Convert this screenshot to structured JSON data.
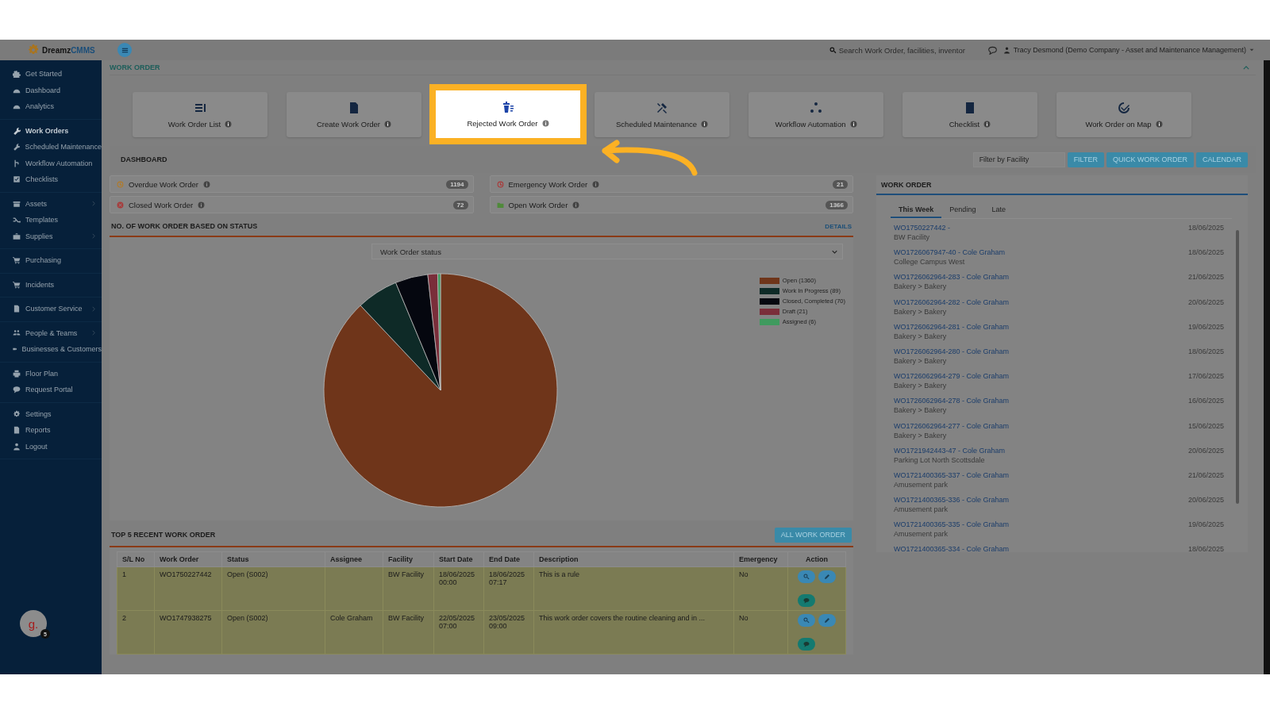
{
  "logo": {
    "name": "Dreamz",
    "accent": "CMMS"
  },
  "header": {
    "search": {
      "placeholder": "Search Work Order, facilities, inventor"
    },
    "user": "Tracy Desmond (Demo Company - Asset and Maintenance Management)"
  },
  "sidebar": {
    "groups": [
      [
        {
          "label": "Get Started",
          "selected": false,
          "expandable": false
        },
        {
          "label": "Dashboard",
          "selected": false,
          "expandable": false
        },
        {
          "label": "Analytics",
          "selected": false,
          "expandable": false
        }
      ],
      [
        {
          "label": "Work Orders",
          "selected": true,
          "expandable": false
        },
        {
          "label": "Scheduled Maintenance",
          "selected": false,
          "expandable": false
        },
        {
          "label": "Workflow Automation",
          "selected": false,
          "expandable": false
        },
        {
          "label": "Checklists",
          "selected": false,
          "expandable": false
        }
      ],
      [
        {
          "label": "Assets",
          "selected": false,
          "expandable": true
        },
        {
          "label": "Templates",
          "selected": false,
          "expandable": false
        },
        {
          "label": "Supplies",
          "selected": false,
          "expandable": true
        }
      ],
      [
        {
          "label": "Purchasing",
          "selected": false,
          "expandable": false
        }
      ],
      [
        {
          "label": "Incidents",
          "selected": false,
          "expandable": false
        }
      ],
      [
        {
          "label": "Customer Service",
          "selected": false,
          "expandable": true
        }
      ],
      [
        {
          "label": "People & Teams",
          "selected": false,
          "expandable": true
        },
        {
          "label": "Businesses & Customers",
          "selected": false,
          "expandable": false
        }
      ],
      [
        {
          "label": "Floor Plan",
          "selected": false,
          "expandable": false
        },
        {
          "label": "Request Portal",
          "selected": false,
          "expandable": false
        }
      ],
      [
        {
          "label": "Settings",
          "selected": false,
          "expandable": false
        },
        {
          "label": "Reports",
          "selected": false,
          "expandable": false
        },
        {
          "label": "Logout",
          "selected": false,
          "expandable": false
        }
      ]
    ]
  },
  "avatar": {
    "letter": "g.",
    "badge": "5"
  },
  "section_title": "WORK ORDER",
  "cards": [
    {
      "label": "Work Order List",
      "highlighted": false
    },
    {
      "label": "Create Work Order",
      "highlighted": false
    },
    {
      "label": "Rejected Work Order",
      "highlighted": true
    },
    {
      "label": "Scheduled Maintenance",
      "highlighted": false
    },
    {
      "label": "Workflow Automation",
      "highlighted": false
    },
    {
      "label": "Checklist",
      "highlighted": false
    },
    {
      "label": "Work Order on Map",
      "highlighted": false
    }
  ],
  "dashboard": {
    "title": "DASHBOARD",
    "filter": {
      "placeholder": "Filter by Facility"
    },
    "buttons": [
      "FILTER",
      "QUICK WORK ORDER",
      "CALENDAR"
    ]
  },
  "stats": [
    {
      "kind": "clock",
      "label": "Overdue Work Order",
      "count": "1194",
      "color": "#b07a2a"
    },
    {
      "kind": "clock",
      "label": "Emergency Work Order",
      "count": "21",
      "color": "#a83a3a"
    },
    {
      "kind": "cancel",
      "label": "Closed Work Order",
      "count": "72",
      "color": "#a83a3a"
    },
    {
      "kind": "folder",
      "label": "Open Work Order",
      "count": "1366",
      "color": "#4f8a3a"
    }
  ],
  "status_chart": {
    "title": "NO. OF WORK ORDER BASED ON STATUS",
    "details": "DETAILS",
    "select": "Work Order status",
    "legend": [
      {
        "color": "#6f351a"
      },
      {
        "color": "#0e2a27"
      },
      {
        "color": "#05070f"
      },
      {
        "color": "#7a2e3a"
      },
      {
        "color": "#3f9a5e"
      }
    ],
    "chart_data": {
      "type": "pie",
      "categories": [
        "Open (1360)",
        "Work In Progress (89)",
        "Closed, Completed (70)",
        "Draft (21)",
        "Assigned (6)"
      ],
      "values": [
        1360,
        89,
        70,
        21,
        6
      ],
      "legend": "right"
    }
  },
  "recent": {
    "title": "TOP 5 RECENT WORK ORDER",
    "button": "ALL WORK ORDER",
    "columns": [
      "S/L No",
      "Work Order",
      "Status",
      "Assignee",
      "Facility",
      "Start Date",
      "End Date",
      "Description",
      "Emergency",
      "Action"
    ],
    "rows": [
      {
        "cells": [
          "1",
          "WO1750227442",
          "Open (S002)",
          "",
          "BW Facility",
          "18/06/2025 00:00",
          "18/06/2025 07:17",
          "This is a rule",
          "No"
        ]
      },
      {
        "cells": [
          "2",
          "WO1747938275",
          "Open (S002)",
          "Cole Graham",
          "BW Facility",
          "22/05/2025 07:00",
          "23/05/2025 09:00",
          "This work order covers the routine cleaning and in ...",
          "No"
        ]
      }
    ]
  },
  "work_order_panel": {
    "title": "WORK ORDER",
    "tabs": [
      {
        "label": "This Week",
        "selected": true
      },
      {
        "label": "Pending",
        "selected": false
      },
      {
        "label": "Late",
        "selected": false
      }
    ],
    "items": [
      {
        "title": "WO1750227442 -",
        "place": "BW Facility",
        "date": "18/06/2025"
      },
      {
        "title": "WO1726067947-40 - Cole Graham",
        "place": "College Campus West",
        "date": "18/06/2025"
      },
      {
        "title": "WO1726062964-283 - Cole Graham",
        "place": "Bakery > Bakery",
        "date": "21/06/2025"
      },
      {
        "title": "WO1726062964-282 - Cole Graham",
        "place": "Bakery > Bakery",
        "date": "20/06/2025"
      },
      {
        "title": "WO1726062964-281 - Cole Graham",
        "place": "Bakery > Bakery",
        "date": "19/06/2025"
      },
      {
        "title": "WO1726062964-280 - Cole Graham",
        "place": "Bakery > Bakery",
        "date": "18/06/2025"
      },
      {
        "title": "WO1726062964-279 - Cole Graham",
        "place": "Bakery > Bakery",
        "date": "17/06/2025"
      },
      {
        "title": "WO1726062964-278 - Cole Graham",
        "place": "Bakery > Bakery",
        "date": "16/06/2025"
      },
      {
        "title": "WO1726062964-277 - Cole Graham",
        "place": "Bakery > Bakery",
        "date": "15/06/2025"
      },
      {
        "title": "WO1721942443-47 - Cole Graham",
        "place": "Parking Lot North Scottsdale",
        "date": "20/06/2025"
      },
      {
        "title": "WO1721400365-337 - Cole Graham",
        "place": "Amusement park",
        "date": "21/06/2025"
      },
      {
        "title": "WO1721400365-336 - Cole Graham",
        "place": "Amusement park",
        "date": "20/06/2025"
      },
      {
        "title": "WO1721400365-335 - Cole Graham",
        "place": "Amusement park",
        "date": "19/06/2025"
      },
      {
        "title": "WO1721400365-334 - Cole Graham",
        "date": "18/06/2025"
      }
    ]
  }
}
